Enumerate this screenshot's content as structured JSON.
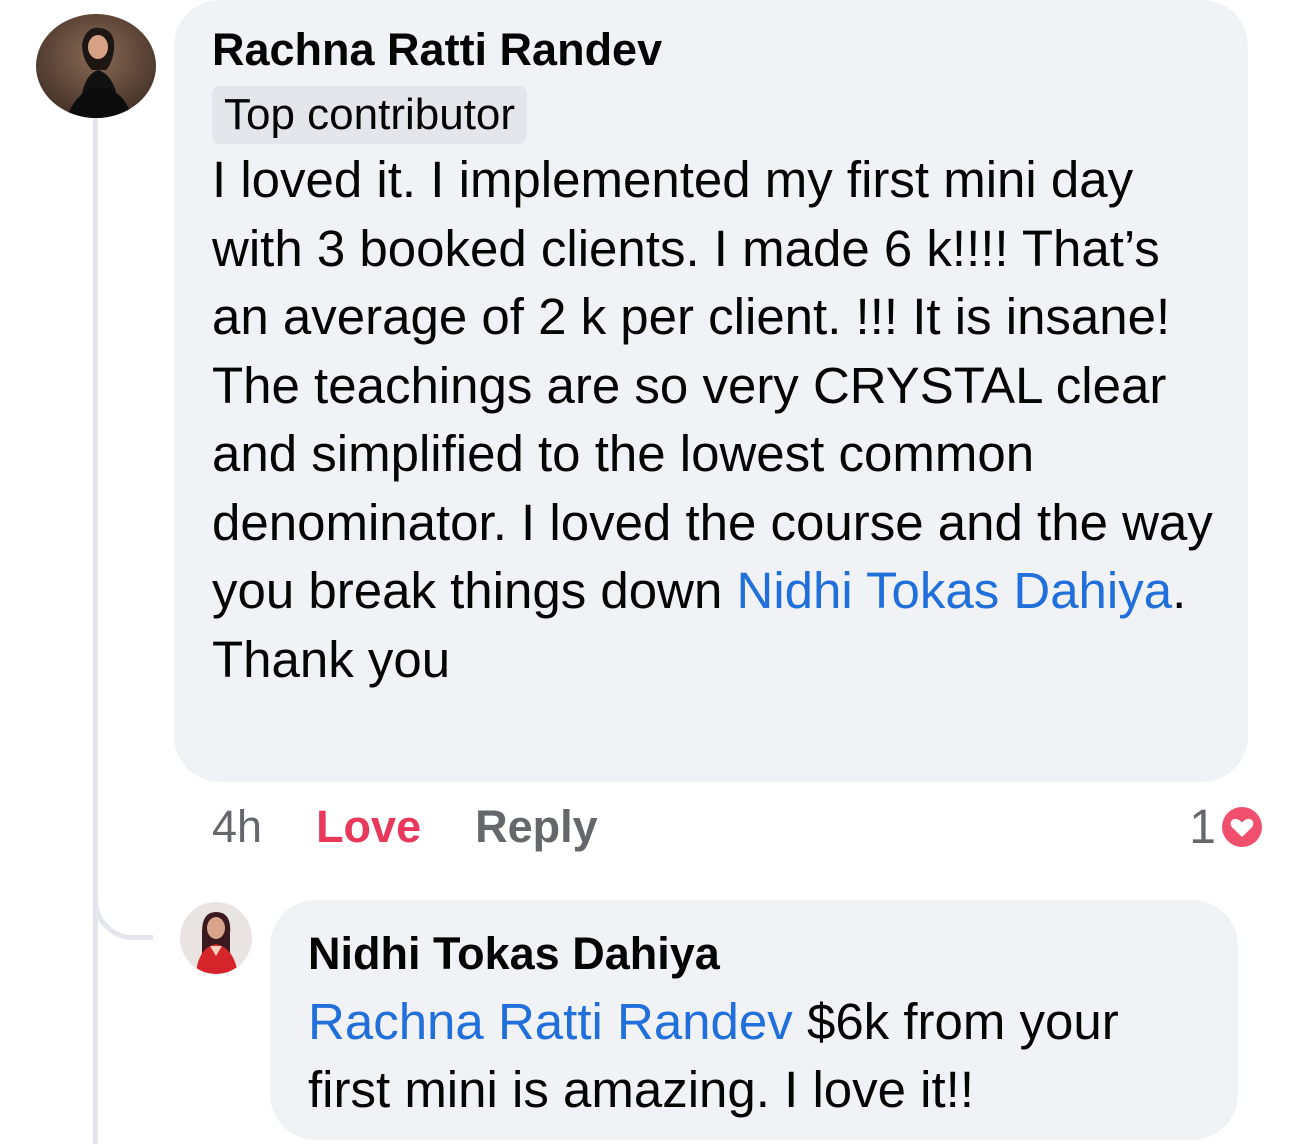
{
  "comment": {
    "author": "Rachna Ratti Randev",
    "badge": "Top contributor",
    "text_part1": "I loved it. I implemented my first mini day with 3 booked clients. I made 6 k!!!! That’s an average of 2 k per client. !!! It is insane!  The teachings are so very CRYSTAL clear and simplified to the lowest common denominator.  I loved the course and the way you break things down ",
    "mention": "Nidhi Tokas Dahiya",
    "text_part2": ". Thank you",
    "time": "4h",
    "love_label": "Love",
    "reply_label": "Reply",
    "reaction_count": "1",
    "reaction_icon": "heart-icon"
  },
  "reply": {
    "author": "Nidhi Tokas Dahiya",
    "mention": "Rachna Ratti Randev",
    "text": " $6k from your first mini is amazing. I love it!!"
  },
  "colors": {
    "bubble": "#f0f2f5",
    "mention": "#216fdb",
    "love": "#e8395c",
    "secondary": "#65676b"
  }
}
